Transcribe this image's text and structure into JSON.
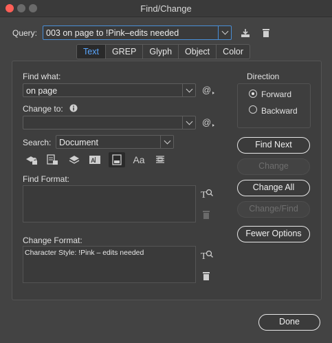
{
  "window": {
    "title": "Find/Change"
  },
  "query": {
    "label": "Query:",
    "value": "003 on page to !Pink–edits needed"
  },
  "tabs": [
    {
      "label": "Text",
      "active": true
    },
    {
      "label": "GREP",
      "active": false
    },
    {
      "label": "Glyph",
      "active": false
    },
    {
      "label": "Object",
      "active": false
    },
    {
      "label": "Color",
      "active": false
    }
  ],
  "find_what": {
    "label": "Find what:",
    "value": "on page"
  },
  "change_to": {
    "label": "Change to:",
    "value": ""
  },
  "search": {
    "label": "Search:",
    "value": "Document"
  },
  "find_format": {
    "label": "Find Format:",
    "value": ""
  },
  "change_format": {
    "label": "Change Format:",
    "value": "Character Style: !Pink – edits needed"
  },
  "direction": {
    "label": "Direction",
    "options": [
      "Forward",
      "Backward"
    ],
    "selected": "Forward"
  },
  "buttons": {
    "find_next": "Find Next",
    "change": "Change",
    "change_all": "Change All",
    "change_find": "Change/Find",
    "fewer_options": "Fewer Options",
    "done": "Done"
  },
  "colors": {
    "accent": "#5aa7ff",
    "close": "#ff5f57",
    "background": "#434343"
  }
}
